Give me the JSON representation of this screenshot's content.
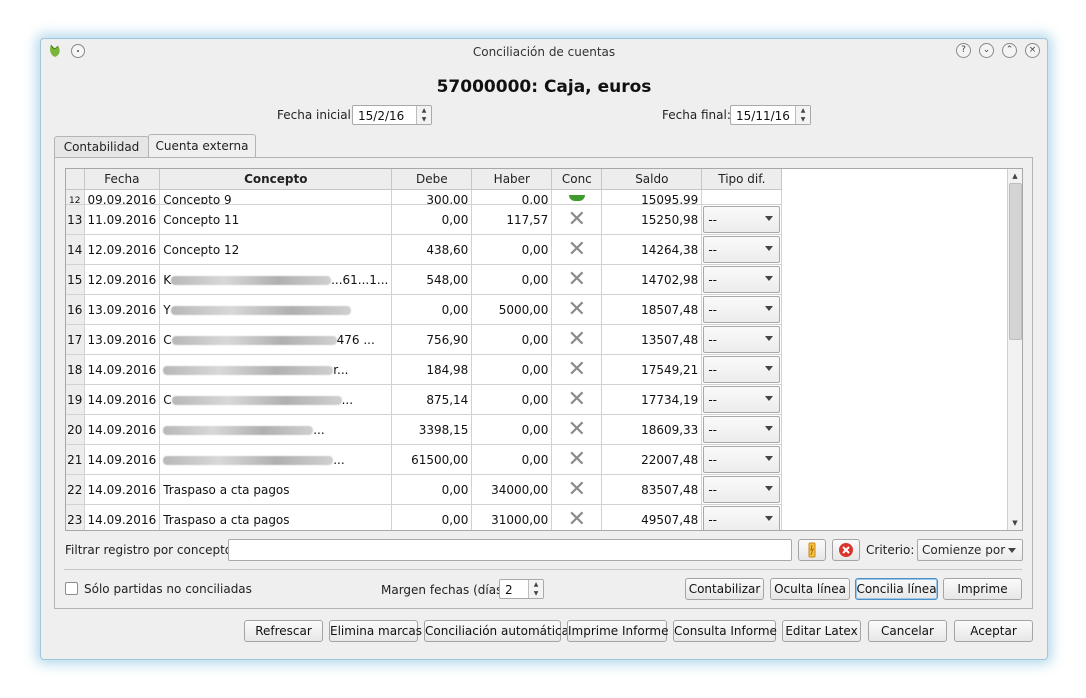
{
  "window": {
    "title": "Conciliación de cuentas",
    "help_glyph": "?",
    "minimize_glyph": "⌄",
    "maximize_glyph": "⌃",
    "close_glyph": "×",
    "icons": [
      "app-icon",
      "pin-icon",
      "help-icon",
      "minimize-icon",
      "maximize-icon",
      "close-icon"
    ]
  },
  "heading": "57000000: Caja, euros",
  "dates": {
    "start_label": "Fecha inicial:",
    "start_value": "15/2/16",
    "end_label": "Fecha final:",
    "end_value": "15/11/16"
  },
  "tabs": [
    {
      "label": "Contabilidad",
      "active": false
    },
    {
      "label": "Cuenta externa",
      "active": true
    }
  ],
  "table": {
    "columns": [
      "Fecha",
      "Concepto",
      "Debe",
      "Haber",
      "Conc",
      "Saldo",
      "Tipo dif."
    ],
    "partial_row": {
      "n": "12",
      "fecha": "09.09.2016",
      "concepto": "Concepto 9",
      "debe": "300,00",
      "haber": "0,00",
      "saldo": "15095,99"
    },
    "rows": [
      {
        "n": "13",
        "fecha": "11.09.2016",
        "concepto": "Concepto 11",
        "debe": "0,00",
        "haber": "117,57",
        "saldo": "15250,98",
        "tipo": "--",
        "blurred": false,
        "suffix": ""
      },
      {
        "n": "14",
        "fecha": "12.09.2016",
        "concepto": "Concepto 12",
        "debe": "438,60",
        "haber": "0,00",
        "saldo": "14264,38",
        "tipo": "--",
        "blurred": false,
        "suffix": ""
      },
      {
        "n": "15",
        "fecha": "12.09.2016",
        "concepto": "K",
        "debe": "548,00",
        "haber": "0,00",
        "saldo": "14702,98",
        "tipo": "--",
        "blurred": true,
        "suffix": "...61...1..."
      },
      {
        "n": "16",
        "fecha": "13.09.2016",
        "concepto": "Y",
        "debe": "0,00",
        "haber": "5000,00",
        "saldo": "18507,48",
        "tipo": "--",
        "blurred": true,
        "suffix": ""
      },
      {
        "n": "17",
        "fecha": "13.09.2016",
        "concepto": "C",
        "debe": "756,90",
        "haber": "0,00",
        "saldo": "13507,48",
        "tipo": "--",
        "blurred": true,
        "suffix": "476 ..."
      },
      {
        "n": "18",
        "fecha": "14.09.2016",
        "concepto": "",
        "debe": "184,98",
        "haber": "0,00",
        "saldo": "17549,21",
        "tipo": "--",
        "blurred": true,
        "suffix": "r..."
      },
      {
        "n": "19",
        "fecha": "14.09.2016",
        "concepto": "C",
        "debe": "875,14",
        "haber": "0,00",
        "saldo": "17734,19",
        "tipo": "--",
        "blurred": true,
        "suffix": "..."
      },
      {
        "n": "20",
        "fecha": "14.09.2016",
        "concepto": "",
        "debe": "3398,15",
        "haber": "0,00",
        "saldo": "18609,33",
        "tipo": "--",
        "blurred": true,
        "suffix": "..."
      },
      {
        "n": "21",
        "fecha": "14.09.2016",
        "concepto": "",
        "debe": "61500,00",
        "haber": "0,00",
        "saldo": "22007,48",
        "tipo": "--",
        "blurred": true,
        "suffix": "..."
      },
      {
        "n": "22",
        "fecha": "14.09.2016",
        "concepto": "Traspaso a cta pagos",
        "debe": "0,00",
        "haber": "34000,00",
        "saldo": "83507,48",
        "tipo": "--",
        "blurred": false,
        "suffix": ""
      },
      {
        "n": "23",
        "fecha": "14.09.2016",
        "concepto": "Traspaso a cta pagos",
        "debe": "0,00",
        "haber": "31000,00",
        "saldo": "49507,48",
        "tipo": "--",
        "blurred": false,
        "suffix": ""
      }
    ]
  },
  "filter": {
    "label": "Filtrar registro por concepto:",
    "value": "",
    "criterio_label": "Criterio:",
    "criterio_value": "Comienze por"
  },
  "options": {
    "solo_label": "Sólo partidas no conciliadas",
    "solo_checked": false,
    "margen_label": "Margen fechas (días)",
    "margen_value": "2",
    "buttons": [
      "Contabilizar",
      "Oculta línea",
      "Concilia línea",
      "Imprime"
    ]
  },
  "footer_buttons": [
    "Refrescar",
    "Elimina marcas",
    "Conciliación automática",
    "Imprime Informe",
    "Consulta Informe",
    "Editar Latex",
    "Cancelar",
    "Aceptar"
  ],
  "colors": {
    "accent": "#4a8fc5",
    "conc_mark": "#8a8a8a",
    "clear_icon": "#d9342b",
    "brush_icon": "#e0a020",
    "window_glow": "#5aaad2"
  }
}
